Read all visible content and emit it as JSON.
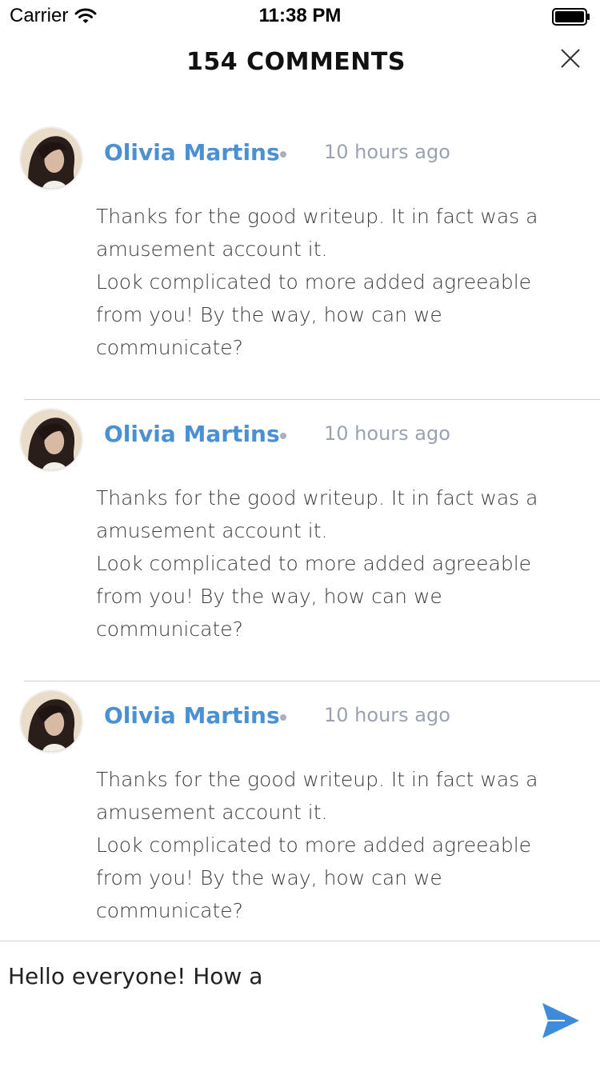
{
  "status_bar": {
    "carrier": "Carrier",
    "time": "11:38 PM",
    "icons": [
      "wifi-icon",
      "battery-icon"
    ]
  },
  "header": {
    "title": "154 COMMENTS",
    "close_label": "X"
  },
  "colors": {
    "author": "#4a90d2",
    "timestamp": "#9aa2b1",
    "send": "#3d8bd9",
    "divider": "#cfcfd4"
  },
  "comments": [
    {
      "author": "Olivia Martins",
      "time": "10 hours ago",
      "line1": "Thanks for the good writeup. It in fact was a amusement account it.",
      "line2": "Look complicated to more added agreeable from you! By the way, how can we communicate?"
    },
    {
      "author": "Olivia Martins",
      "time": "10 hours ago",
      "line1": "Thanks for the good writeup. It in fact was a amusement account it.",
      "line2": "Look complicated to more added agreeable from you! By the way, how can we communicate?"
    },
    {
      "author": "Olivia Martins",
      "time": "10 hours ago",
      "line1": "Thanks for the good writeup. It in fact was a amusement account it.",
      "line2": "Look complicated to more added agreeable from you! By the way, how can we communicate?"
    }
  ],
  "composer": {
    "value": "Hello everyone! How a",
    "send_icon": "send-icon"
  }
}
